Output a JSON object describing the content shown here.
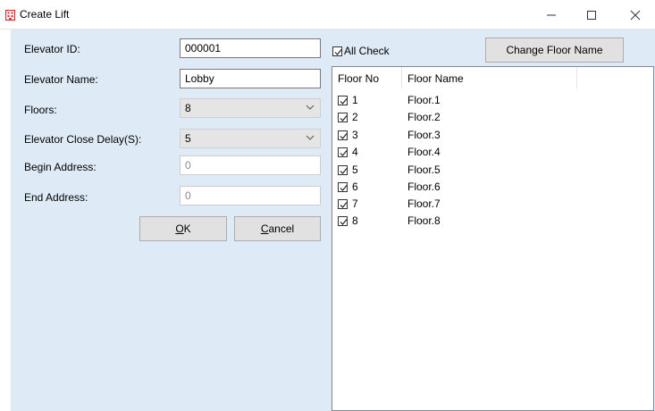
{
  "window": {
    "title": "Create Lift",
    "minimize_glyph": "—",
    "maximize_glyph": "☐",
    "close_glyph": "✕"
  },
  "form": {
    "elevator_id_label": "Elevator ID:",
    "elevator_id_value": "000001",
    "elevator_name_label": "Elevator Name:",
    "elevator_name_value": "Lobby",
    "floors_label": "Floors:",
    "floors_value": "8",
    "close_delay_label": "Elevator Close Delay(S):",
    "close_delay_value": "5",
    "begin_address_label": "Begin Address:",
    "begin_address_value": "0",
    "end_address_label": "End Address:",
    "end_address_value": "0"
  },
  "buttons": {
    "ok_mnemonic": "O",
    "ok_rest": "K",
    "cancel_mnemonic": "C",
    "cancel_rest": "ancel",
    "change_floor_name": "Change Floor Name"
  },
  "all_check": {
    "label": "All Check",
    "checked": true
  },
  "floor_list": {
    "columns": [
      "Floor No",
      "Floor Name"
    ],
    "rows": [
      {
        "no": "1",
        "name": "Floor.1",
        "checked": true
      },
      {
        "no": "2",
        "name": "Floor.2",
        "checked": true
      },
      {
        "no": "3",
        "name": "Floor.3",
        "checked": true
      },
      {
        "no": "4",
        "name": "Floor.4",
        "checked": true
      },
      {
        "no": "5",
        "name": "Floor.5",
        "checked": true
      },
      {
        "no": "6",
        "name": "Floor.6",
        "checked": true
      },
      {
        "no": "7",
        "name": "Floor.7",
        "checked": true
      },
      {
        "no": "8",
        "name": "Floor.8",
        "checked": true
      }
    ]
  },
  "icons": {
    "app": "building-icon",
    "dropdown": "chevron-down-icon",
    "check": "checkmark-icon"
  },
  "colors": {
    "client_background": "#deeaf5",
    "app_icon": "#d9262c"
  }
}
